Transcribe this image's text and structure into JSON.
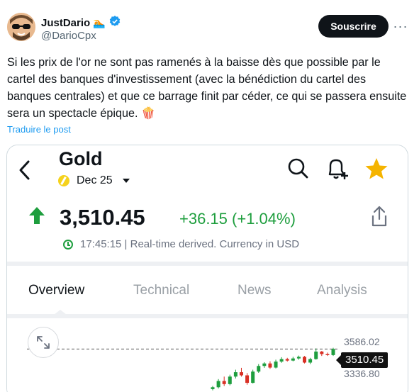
{
  "tweet": {
    "author_name": "JustDario",
    "author_emoji": "🏊",
    "handle": "@DarioCpx",
    "subscribe_label": "Souscrire",
    "more_label": "···",
    "text": "Si les prix de l'or ne sont pas ramenés à la baisse dès que possible par le cartel des banques d'investissement (avec la bénédiction du cartel des banques centrales) et que ce barrage finit par céder, ce qui se passera ensuite sera un spectacle épique. 🍿",
    "translate_label": "Traduire le post"
  },
  "embedded_app": {
    "title": "Gold",
    "contract": "Dec 25",
    "price": "3,510.45",
    "change": "+36.15 (+1.04%)",
    "time_info": "17:45:15 | Real-time derived. Currency in USD",
    "tabs": [
      {
        "label": "Overview",
        "active": true
      },
      {
        "label": "Technical",
        "active": false
      },
      {
        "label": "News",
        "active": false
      },
      {
        "label": "Analysis",
        "active": false
      }
    ],
    "icons": {
      "back": "back-arrow-icon",
      "search": "search-icon",
      "alert": "bell-plus-icon",
      "favorite": "star-icon",
      "share": "share-icon",
      "expand": "expand-icon"
    },
    "colors": {
      "up": "#1e9e3e",
      "down": "#d93025",
      "star": "#f5b400"
    }
  },
  "chart_data": {
    "type": "candlestick",
    "y_tick_labels": [
      "3586.02",
      "3336.80"
    ],
    "last_price_label": "3510.45",
    "candles": [
      {
        "open": 3190,
        "close": 3205,
        "high": 3215,
        "low": 3180
      },
      {
        "open": 3205,
        "close": 3255,
        "high": 3270,
        "low": 3195
      },
      {
        "open": 3255,
        "close": 3230,
        "high": 3290,
        "low": 3215
      },
      {
        "open": 3230,
        "close": 3290,
        "high": 3305,
        "low": 3220
      },
      {
        "open": 3290,
        "close": 3325,
        "high": 3345,
        "low": 3275
      },
      {
        "open": 3325,
        "close": 3300,
        "high": 3360,
        "low": 3290
      },
      {
        "open": 3300,
        "close": 3240,
        "high": 3318,
        "low": 3225
      },
      {
        "open": 3240,
        "close": 3330,
        "high": 3345,
        "low": 3235
      },
      {
        "open": 3330,
        "close": 3375,
        "high": 3390,
        "low": 3320
      },
      {
        "open": 3375,
        "close": 3395,
        "high": 3405,
        "low": 3360
      },
      {
        "open": 3395,
        "close": 3362,
        "high": 3412,
        "low": 3352
      },
      {
        "open": 3362,
        "close": 3410,
        "high": 3425,
        "low": 3355
      },
      {
        "open": 3410,
        "close": 3430,
        "high": 3445,
        "low": 3400
      },
      {
        "open": 3430,
        "close": 3418,
        "high": 3440,
        "low": 3410
      },
      {
        "open": 3418,
        "close": 3435,
        "high": 3448,
        "low": 3412
      },
      {
        "open": 3435,
        "close": 3448,
        "high": 3458,
        "low": 3425
      },
      {
        "open": 3448,
        "close": 3402,
        "high": 3455,
        "low": 3395
      },
      {
        "open": 3402,
        "close": 3430,
        "high": 3440,
        "low": 3390
      },
      {
        "open": 3430,
        "close": 3490,
        "high": 3515,
        "low": 3425
      },
      {
        "open": 3490,
        "close": 3470,
        "high": 3495,
        "low": 3455
      },
      {
        "open": 3470,
        "close": 3462,
        "high": 3482,
        "low": 3455
      },
      {
        "open": 3462,
        "close": 3510,
        "high": 3520,
        "low": 3455
      }
    ]
  }
}
